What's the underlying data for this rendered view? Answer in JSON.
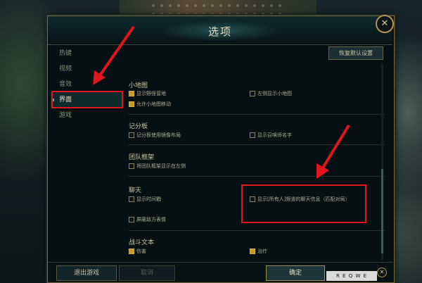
{
  "dialog": {
    "title": "选项",
    "close_icon": "close-icon",
    "reset_label": "恢复默认设置"
  },
  "sidebar": {
    "items": [
      {
        "label": "热键"
      },
      {
        "label": "视频"
      },
      {
        "label": "音效"
      },
      {
        "label": "界面",
        "active": true
      },
      {
        "label": "游戏"
      }
    ]
  },
  "sections": {
    "minimap": {
      "title": "小地图",
      "options": [
        {
          "label": "显示野怪营地",
          "checked": true
        },
        {
          "label": "左侧显示小地图",
          "checked": false
        },
        {
          "label": "允许小地图移动",
          "checked": true
        }
      ]
    },
    "scoreboard": {
      "title": "记分板",
      "options": [
        {
          "label": "记分板使用镜像布局",
          "checked": false
        },
        {
          "label": "显示召唤师名字",
          "checked": false
        }
      ]
    },
    "team_frame": {
      "title": "团队框架",
      "options": [
        {
          "label": "将团队框架显示在左侧",
          "checked": false
        }
      ]
    },
    "chat": {
      "title": "聊天",
      "options": [
        {
          "label": "显示时间戳",
          "checked": false
        },
        {
          "label": "显示[所有人]频道的聊天信息（匹配对局）",
          "checked": false
        },
        {
          "label": "屏蔽敌方表情",
          "checked": false
        }
      ]
    },
    "combat_text": {
      "title": "战斗文本",
      "options": [
        {
          "label": "伤害",
          "checked": true
        },
        {
          "label": "治疗",
          "checked": true
        }
      ]
    }
  },
  "footer": {
    "exit_label": "退出游戏",
    "cancel_label": "取消",
    "ok_label": "确定",
    "hotkeys": "R E Q W E"
  },
  "colors": {
    "accent_red": "#e0151d",
    "gold": "#c99a22",
    "frame": "#7a6a3d"
  }
}
